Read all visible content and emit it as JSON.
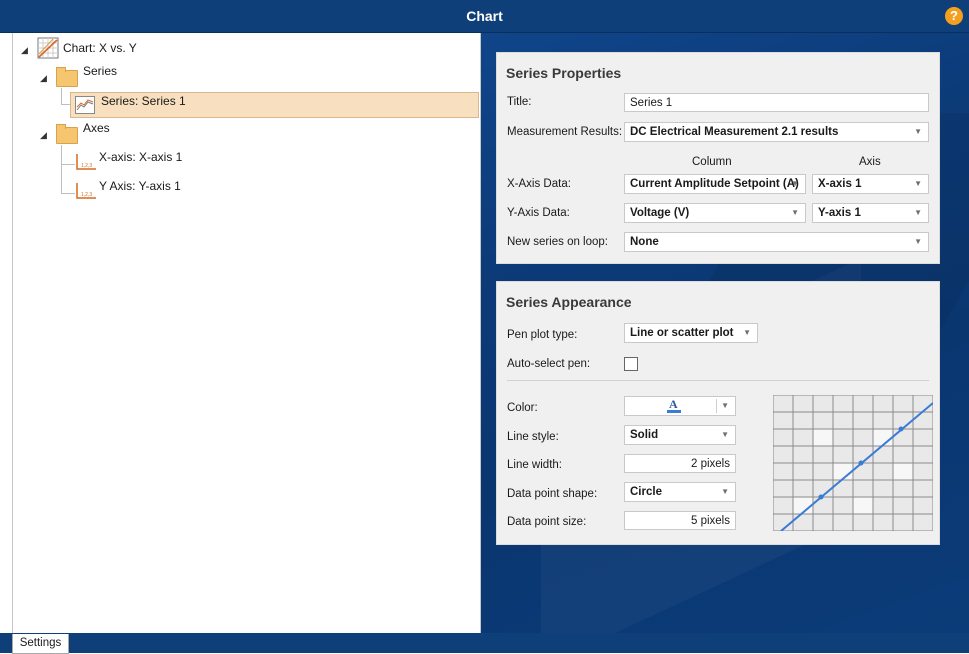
{
  "window": {
    "title": "Chart",
    "help_label": "?"
  },
  "tree": {
    "root_label": "Chart: X vs. Y",
    "series_folder_label": "Series",
    "series_item_label": "Series:  Series 1",
    "axes_folder_label": "Axes",
    "x_axis_item_label": "X-axis:  X-axis 1",
    "y_axis_item_label": "Y Axis:  Y-axis 1",
    "expand_glyph": "◢",
    "axis_icon_text": "1,2,3"
  },
  "series_properties": {
    "heading": "Series Properties",
    "title_label": "Title:",
    "title_value": "Series 1",
    "measurement_label": "Measurement Results:",
    "measurement_value": "DC Electrical Measurement 2.1 results",
    "column_header": "Column",
    "axis_header": "Axis",
    "x_axis_data_label": "X-Axis Data:",
    "x_axis_column_value": "Current Amplitude Setpoint (A)",
    "x_axis_axis_value": "X-axis 1",
    "y_axis_data_label": "Y-Axis Data:",
    "y_axis_column_value": "Voltage (V)",
    "y_axis_axis_value": "Y-axis 1",
    "new_series_label": "New series on loop:",
    "new_series_value": "None"
  },
  "series_appearance": {
    "heading": "Series Appearance",
    "pen_plot_type_label": "Pen plot type:",
    "pen_plot_type_value": "Line or scatter plot",
    "auto_select_label": "Auto-select pen:",
    "auto_select_checked": false,
    "color_label": "Color:",
    "color_glyph": "A",
    "color_value": "#3a7bd5",
    "line_style_label": "Line style:",
    "line_style_value": "Solid",
    "line_width_label": "Line width:",
    "line_width_value": "2 pixels",
    "point_shape_label": "Data point shape:",
    "point_shape_value": "Circle",
    "point_size_label": "Data point size:",
    "point_size_value": "5 pixels"
  },
  "footer": {
    "settings_tab_label": "Settings"
  },
  "colors": {
    "title_bar": "#0f3f78",
    "selection": "#f8dfbf",
    "accent_line": "#3a7bd5",
    "help_badge": "#f3a021"
  }
}
